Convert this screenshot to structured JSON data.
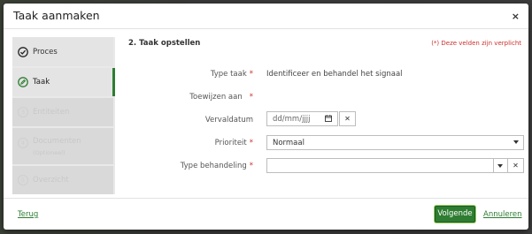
{
  "modal": {
    "title": "Taak aanmaken",
    "close_glyph": "×"
  },
  "steps": [
    {
      "number": "",
      "label": "Proces",
      "sub": "",
      "state": "done"
    },
    {
      "number": "",
      "label": "Taak",
      "sub": "",
      "state": "active"
    },
    {
      "number": "3",
      "label": "Entiteiten",
      "sub": "",
      "state": "pending"
    },
    {
      "number": "4",
      "label": "Documenten",
      "sub": "(Optioneel)",
      "state": "pending"
    },
    {
      "number": "5",
      "label": "Overzicht",
      "sub": "",
      "state": "pending"
    }
  ],
  "form": {
    "section_title": "2. Taak opstellen",
    "required_note": "(*) Deze velden zijn verplicht",
    "required_marker": "*",
    "type_taak": {
      "label": "Type taak",
      "value": "Identificeer en behandel het signaal"
    },
    "toewijzen": {
      "label": "Toewijzen aan"
    },
    "vervaldatum": {
      "label": "Vervaldatum",
      "placeholder": "dd/mm/jjjj",
      "clear_glyph": "✕"
    },
    "prioriteit": {
      "label": "Prioriteit",
      "value": "Normaal"
    },
    "type_behandeling": {
      "label": "Type behandeling",
      "value": "",
      "clear_glyph": "✕"
    }
  },
  "footer": {
    "back_label": "Terug",
    "next_label": "Volgende",
    "cancel_label": "Annuleren"
  },
  "colors": {
    "accent": "#2e7d32",
    "required": "#c9302c"
  },
  "icons": {
    "step_done": "check-circle-icon",
    "step_active": "pencil-circle-icon",
    "calendar": "calendar-icon",
    "close": "close-icon",
    "chevron": "chevron-down-icon"
  }
}
